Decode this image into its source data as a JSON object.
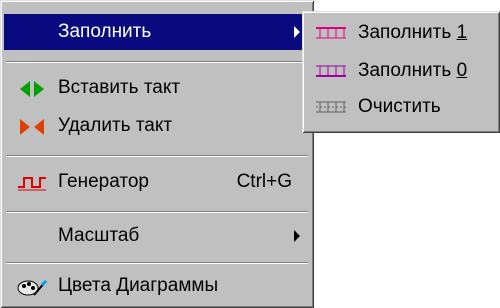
{
  "menu": {
    "items": [
      {
        "label": "Заполнить",
        "has_submenu": true,
        "selected": true
      },
      {
        "label": "Вставить такт"
      },
      {
        "label": "Удалить такт"
      },
      {
        "label": "Генератор",
        "shortcut": "Ctrl+G"
      },
      {
        "label": "Масштаб",
        "has_submenu": true
      },
      {
        "label": "Цвета Диаграммы"
      }
    ]
  },
  "submenu": {
    "items": [
      {
        "label_prefix": "Заполнить ",
        "label_accent": "1"
      },
      {
        "label_prefix": "Заполнить ",
        "label_accent": "0"
      },
      {
        "label": "Очистить"
      }
    ]
  },
  "colors": {
    "selection": "#0a0a80",
    "menu_face": "#c0c0c0",
    "insert_icon": "#00a000",
    "delete_icon": "#e04000",
    "generator_icon": "#e00000",
    "fill1_icon": "#e00080",
    "fill0_icon": "#a000a0"
  },
  "icons": {
    "fill": "fill-menu-icon",
    "insert": "insert-beat-icon",
    "delete": "delete-beat-icon",
    "generator": "generator-icon",
    "colors": "palette-brush-icon",
    "fill1": "fill-one-icon",
    "fill0": "fill-zero-icon",
    "clear": "clear-icon"
  }
}
